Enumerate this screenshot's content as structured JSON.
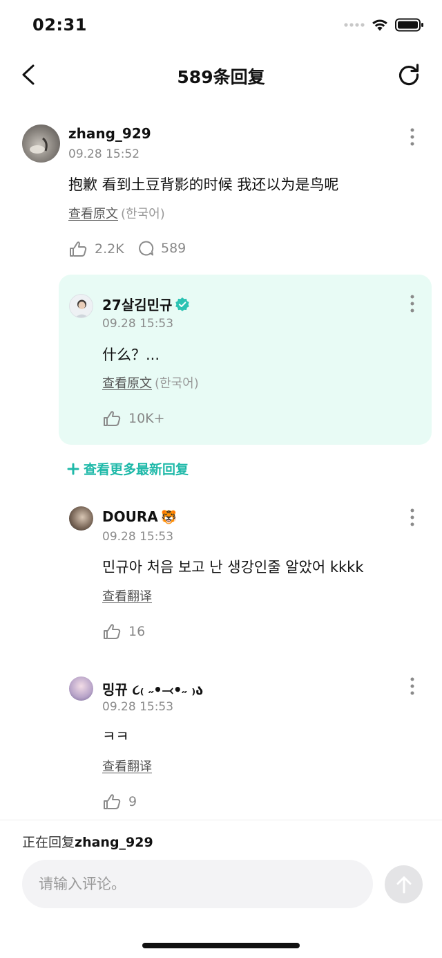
{
  "status_bar": {
    "time": "02:31"
  },
  "header": {
    "title": "589条回复"
  },
  "main_comment": {
    "username": "zhang_929",
    "timestamp": "09.28 15:52",
    "text": "抱歉 看到土豆背影的时候 我还以为是鸟呢",
    "view_link": "查看原文",
    "language": "(한국어)",
    "likes": "2.2K",
    "replies": "589"
  },
  "highlighted_reply": {
    "username": "27살김민규",
    "timestamp": "09.28 15:53",
    "text": "什么？...",
    "view_link": "查看原文",
    "language": "(한국어)",
    "likes": "10K+"
  },
  "more_replies_label": "查看更多最新回复",
  "replies": [
    {
      "username": "DOURA",
      "emoji": "🐯",
      "timestamp": "09.28 15:53",
      "text": "민규아 처음 보고 난 생강인줄 알았어 kkkk",
      "view_link": "查看翻译",
      "likes": "16"
    },
    {
      "username": "밍뀨 ૮₍ ˶•⤙•˶ ₎ა",
      "timestamp": "09.28 15:53",
      "text": "ㅋㅋ",
      "view_link": "查看翻译",
      "likes": "9"
    }
  ],
  "composer": {
    "replying_prefix": "正在回复",
    "replying_user": "zhang_929",
    "placeholder": "请输入评论。"
  },
  "colors": {
    "accent": "#1fb9a9",
    "highlight_bg": "#e8fbf5",
    "verified": "#2cc3b3"
  }
}
